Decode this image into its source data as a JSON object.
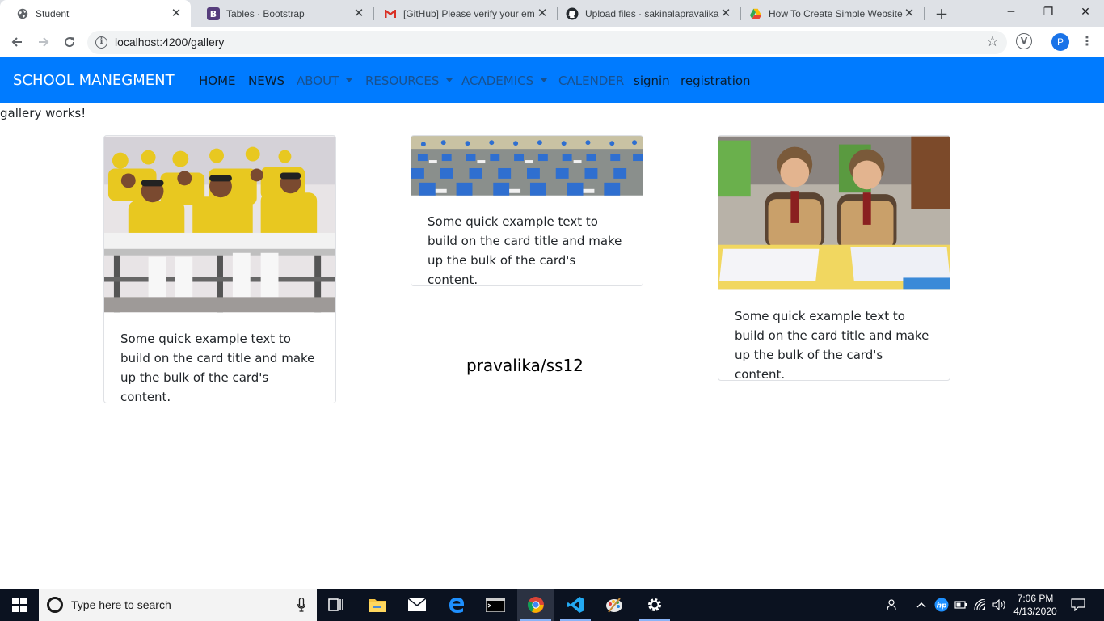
{
  "browser": {
    "tabs": [
      {
        "title": "Student",
        "icon": "globe-icon"
      },
      {
        "title": "Tables · Bootstrap",
        "icon": "bootstrap-icon"
      },
      {
        "title": "[GitHub] Please verify your em",
        "icon": "gmail-icon"
      },
      {
        "title": "Upload files · sakinalapravalika",
        "icon": "github-icon"
      },
      {
        "title": "How To Create Simple Website",
        "icon": "gdrive-icon"
      }
    ],
    "url": "localhost:4200/gallery",
    "profile_initial": "P"
  },
  "navbar": {
    "brand": "SCHOOL MANEGMENT",
    "links": [
      {
        "label": "HOME",
        "dropdown": false,
        "muted": false
      },
      {
        "label": "NEWS",
        "dropdown": false,
        "muted": false
      },
      {
        "label": "ABOUT",
        "dropdown": true,
        "muted": true
      },
      {
        "label": "RESOURCES",
        "dropdown": true,
        "muted": true
      },
      {
        "label": "ACADEMICS",
        "dropdown": true,
        "muted": true
      },
      {
        "label": "CALENDER",
        "dropdown": false,
        "muted": true
      },
      {
        "label": "signin",
        "dropdown": false,
        "muted": false
      },
      {
        "label": "registration",
        "dropdown": false,
        "muted": false
      }
    ],
    "color": "#007bff"
  },
  "page": {
    "heading": "gallery works!",
    "cards": [
      {
        "image": "students-writing-exam-photo",
        "text": "Some quick example text to build on the card title and make up the bulk of the card's content."
      },
      {
        "image": "students-seated-on-floor-photo",
        "text": "Some quick example text to build on the card title and make up the bulk of the card's content."
      },
      {
        "image": "two-boys-at-desk-photo",
        "text": "Some quick example text to build on the card title and make up the bulk of the card's content."
      }
    ],
    "footer": "pravalika/ss12"
  },
  "taskbar": {
    "search_placeholder": "Type here to search",
    "time": "7:06 PM",
    "date": "4/13/2020"
  }
}
